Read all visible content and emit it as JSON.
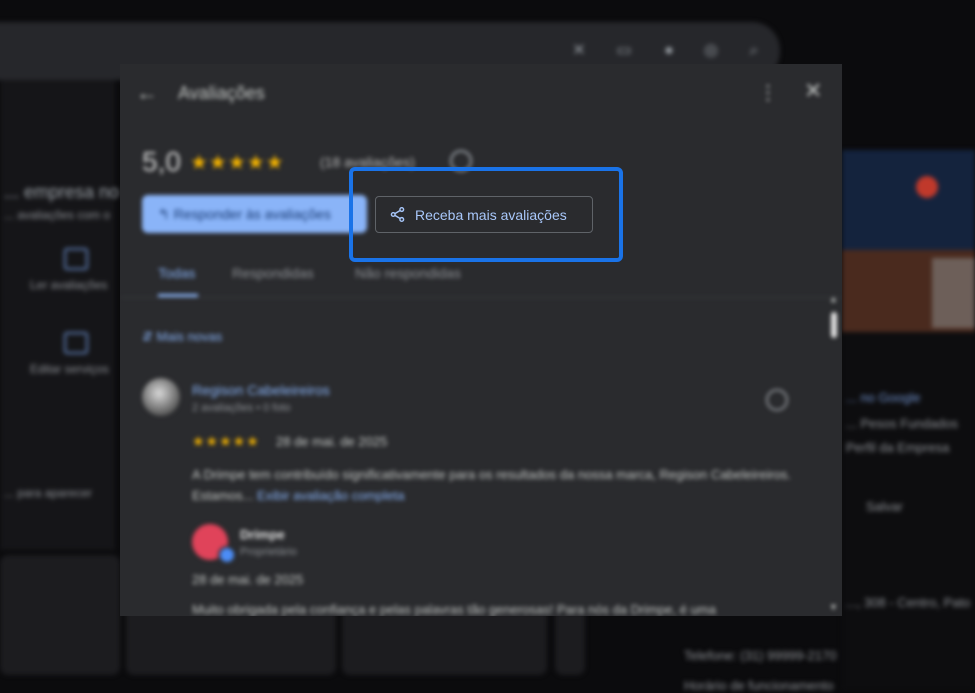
{
  "dialog": {
    "title": "Avaliações",
    "back_icon": "arrow-left-icon",
    "more_icon": "more-vert-icon",
    "close_icon": "close-icon",
    "rating": "5,0",
    "stars": "★★★★★",
    "rating_count": "(18 avaliações)",
    "reply_button": "Responder às avaliações",
    "share_button": "Receba mais avaliações",
    "tabs": [
      {
        "label": "Todas"
      },
      {
        "label": "Respondidas"
      },
      {
        "label": "Não respondidas"
      }
    ],
    "sort_label": "Mais novas",
    "review": {
      "author": "Regison Cabeleireiros",
      "meta": "2 avaliações • 0 foto",
      "stars": "★★★★★",
      "date": "28 de mai. de 2025",
      "text": "A Drimpe tem contribuído significativamente para os resultados da nossa marca, Regison Cabeleireiros. Estamos...",
      "more_link": "Exibir avaliação completa"
    },
    "owner_reply": {
      "name": "Drimpe",
      "role": "Proprietário",
      "date": "28 de mai. de 2025",
      "text": "Muito obrigada pela confiança e pelas palavras tão generosas! Para nós da Drimpe, é uma"
    }
  },
  "background": {
    "left_texts": [
      "... empresa no",
      "... avaliações com o",
      "Ler avaliações",
      "Editar serviços",
      "... para aparecer"
    ],
    "right_texts": [
      "... no Google",
      "... Pesos Fundados",
      "Perfil da Empresa",
      "Salvar",
      "..., 308 - Centro, Pato",
      "Telefone: (31) 99999-2170",
      "Horário de funcionamento"
    ]
  },
  "colors": {
    "accent": "#8ab4f8",
    "highlight_border": "#1a73e8",
    "star": "#f5b400",
    "dialog_bg": "#2a2b2e"
  }
}
